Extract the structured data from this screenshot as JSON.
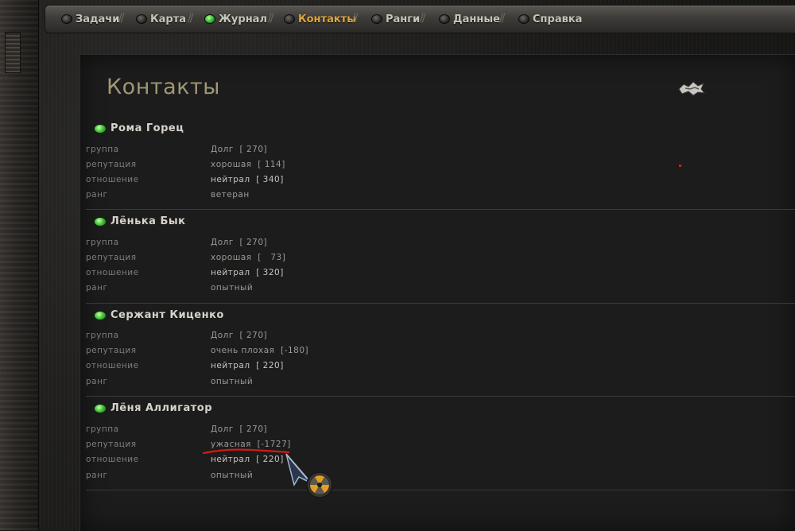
{
  "tabs": [
    {
      "label": "Задачи",
      "active": false,
      "led": "off"
    },
    {
      "label": "Карта",
      "active": false,
      "led": "off"
    },
    {
      "label": "Журнал",
      "active": false,
      "led": "green"
    },
    {
      "label": "Контакты",
      "active": true,
      "led": "off"
    },
    {
      "label": "Ранги",
      "active": false,
      "led": "off"
    },
    {
      "label": "Данные",
      "active": false,
      "led": "off"
    },
    {
      "label": "Справка",
      "active": false,
      "led": "off"
    }
  ],
  "page_title": "Контакты",
  "field_labels": {
    "group": "группа",
    "reputation": "репутация",
    "attitude": "отношение",
    "rank": "ранг"
  },
  "contacts": [
    {
      "name": "Рома Горец",
      "group": "Долг  [ 270]",
      "reputation": "хорошая  [ 114]",
      "attitude": "нейтрал  [ 340]",
      "rank": "ветеран"
    },
    {
      "name": "Лёнька Бык",
      "group": "Долг  [ 270]",
      "reputation": "хорошая  [   73]",
      "attitude": "нейтрал  [ 320]",
      "rank": "опытный"
    },
    {
      "name": "Сержант Киценко",
      "group": "Долг  [ 270]",
      "reputation": "очень плохая  [-180]",
      "attitude": "нейтрал  [ 220]",
      "rank": "опытный"
    },
    {
      "name": "Лёня Аллигатор",
      "group": "Долг  [ 270]",
      "reputation": "ужасная  [-1727]",
      "attitude": "нейтрал  [ 220]",
      "rank": "опытный"
    }
  ],
  "colors": {
    "accent_tab": "#e0a63a",
    "title": "#a09773",
    "annotation": "#d21a14"
  },
  "icons": {
    "close": "close-icon",
    "cursor": "radiation-cursor-icon"
  }
}
